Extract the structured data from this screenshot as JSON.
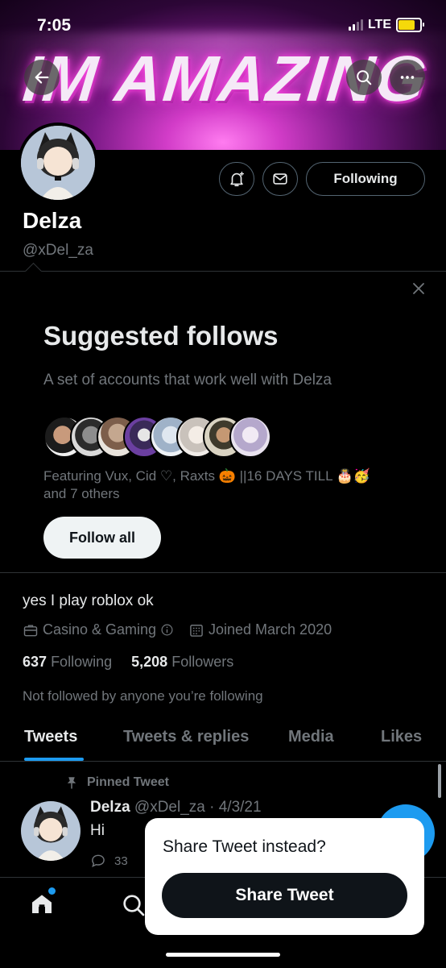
{
  "status_bar": {
    "time": "7:05",
    "network": "LTE"
  },
  "banner": {
    "text": "IM AMAZING"
  },
  "header": {
    "back_icon": "arrow-left-icon",
    "search_icon": "search-icon",
    "more_icon": "more-horizontal-icon"
  },
  "profile": {
    "name": "Delza",
    "handle": "@xDel_za",
    "following_button": "Following",
    "bio": "yes I play roblox ok",
    "category": "Casino & Gaming",
    "joined": "Joined March 2020",
    "following_count": "637",
    "following_label": "Following",
    "followers_count": "5,208",
    "followers_label": "Followers",
    "not_followed_text": "Not followed by anyone you’re following"
  },
  "suggested": {
    "title": "Suggested follows",
    "subtitle": "A set of accounts that work well with Delza",
    "featuring_line1": "Featuring Vux, Cid ♡, Raxts 🎃 ||16 DAYS TILL 🎂🥳",
    "featuring_line2": "and 7 others",
    "follow_all": "Follow all"
  },
  "tabs": [
    {
      "label": "Tweets"
    },
    {
      "label": "Tweets & replies"
    },
    {
      "label": "Media"
    },
    {
      "label": "Likes"
    }
  ],
  "pinned_tweet": {
    "pinned_label": "Pinned Tweet",
    "author": "Delza",
    "meta": "@xDel_za · 4/3/21",
    "text": "Hi",
    "reply_count": "33"
  },
  "share_popup": {
    "question": "Share Tweet instead?",
    "button": "Share Tweet"
  },
  "colors": {
    "accent": "#1d9bf0",
    "background": "#000000",
    "secondary_text": "#71767b"
  }
}
